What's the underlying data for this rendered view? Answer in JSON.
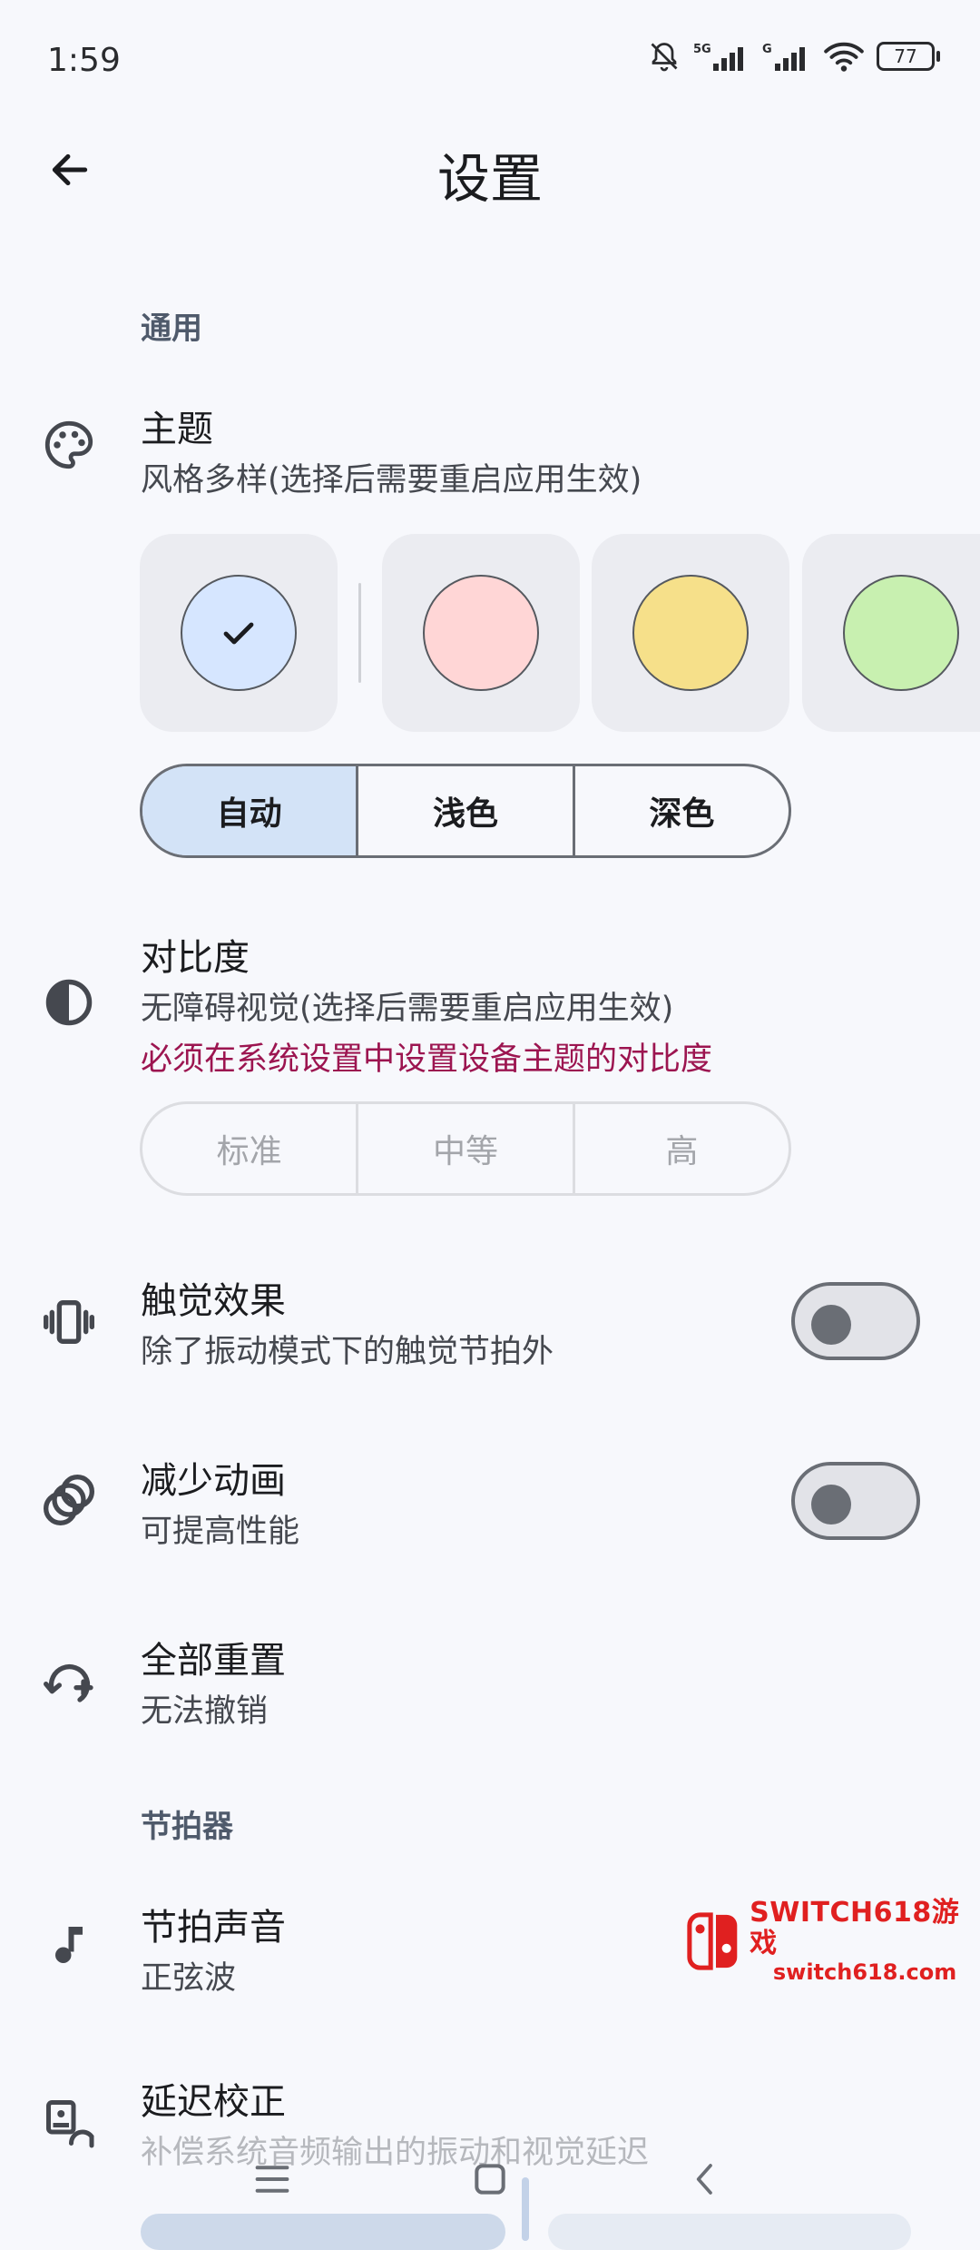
{
  "status_bar": {
    "time": "1:59",
    "icons": [
      "muted-bell-icon",
      "signal-5g-icon",
      "signal-g-icon",
      "wifi-icon"
    ],
    "battery": "77"
  },
  "header": {
    "title": "设置",
    "back_icon": "arrow-left-icon"
  },
  "general": {
    "section_label": "通用",
    "theme": {
      "title": "主题",
      "subtitle": "风格多样(选择后需要重启应用生效)",
      "swatches": [
        "#d6e6ff",
        "#ffd6d6",
        "#f6e08a",
        "#c8f0b0"
      ],
      "selected_swatch": 0,
      "modes": [
        "自动",
        "浅色",
        "深色"
      ],
      "selected_mode": "自动"
    },
    "contrast": {
      "title": "对比度",
      "subtitle": "无障碍视觉(选择后需要重启应用生效)",
      "warning": "必须在系统设置中设置设备主题的对比度",
      "options": [
        "标准",
        "中等",
        "高"
      ]
    },
    "haptics": {
      "title": "触觉效果",
      "subtitle": "除了振动模式下的触觉节拍外",
      "enabled": false
    },
    "reduce_motion": {
      "title": "减少动画",
      "subtitle": "可提高性能",
      "enabled": false
    },
    "reset": {
      "title": "全部重置",
      "subtitle": "无法撤销"
    }
  },
  "metronome": {
    "section_label": "节拍器",
    "sound": {
      "title": "节拍声音",
      "subtitle": "正弦波"
    },
    "latency": {
      "title": "延迟校正",
      "subtitle": "补偿系统音频输出的振动和视觉延迟"
    }
  },
  "watermark": {
    "brand": "SWITCH618游戏",
    "url": "switch618.com"
  },
  "nav_bar": {
    "icons": [
      "menu-icon",
      "home-square-icon",
      "back-chevron-icon"
    ]
  }
}
